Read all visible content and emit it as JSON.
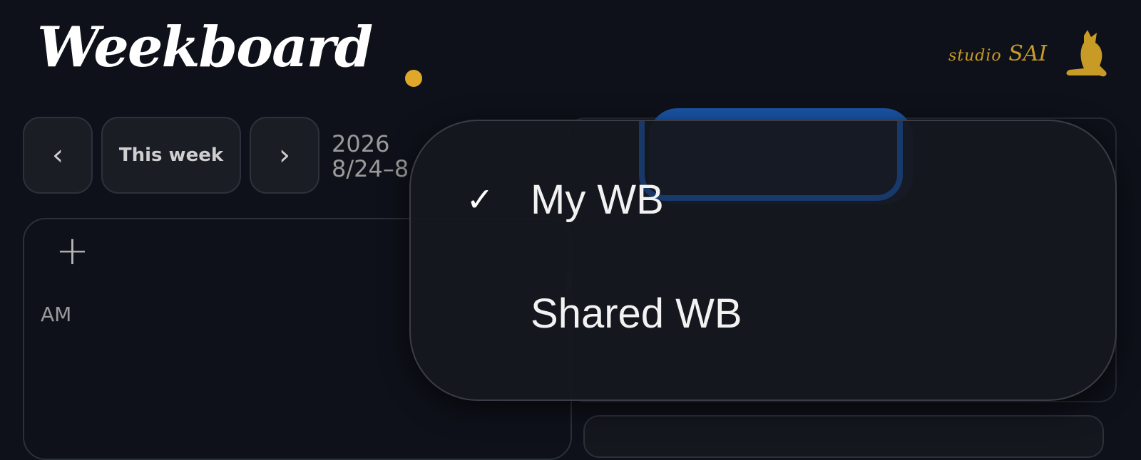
{
  "header": {
    "app_title": "Weekboard",
    "brand_small": "studio",
    "brand_large": "SAI"
  },
  "nav": {
    "prev_label": "‹",
    "this_week_label": "This week",
    "next_label": "›",
    "year": "2026",
    "range": "8/24–8"
  },
  "board": {
    "add_label": "+",
    "am_label": "AM"
  },
  "menu": {
    "items": [
      {
        "label": "My WB",
        "checked": true,
        "check_mark": "✓"
      },
      {
        "label": "Shared WB",
        "checked": false,
        "check_mark": ""
      }
    ]
  },
  "colors": {
    "accent_dot": "#e0a82a",
    "brand_gold": "#c89a26",
    "selector_blue": "#1a55a8"
  }
}
